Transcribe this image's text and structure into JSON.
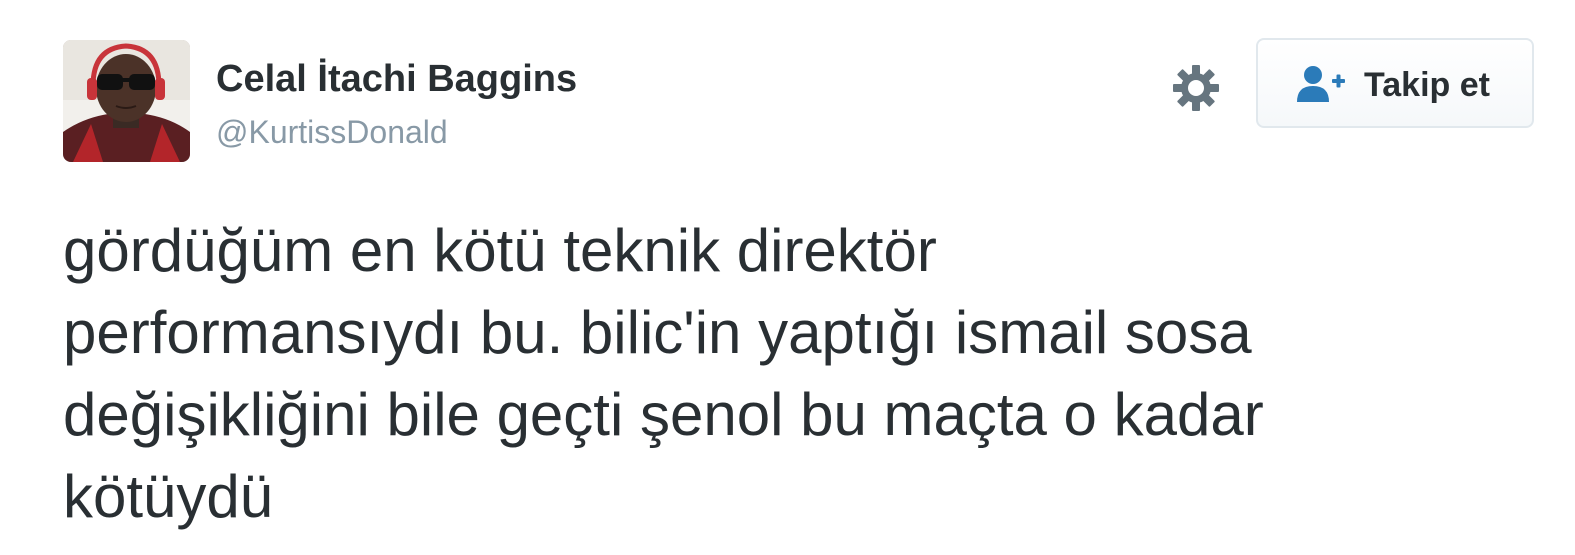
{
  "user": {
    "display_name": "Celal İtachi Baggins",
    "handle": "@KurtissDonald"
  },
  "actions": {
    "settings_icon": "gear-icon",
    "follow_icon": "add-user-icon",
    "follow_label": "Takip et",
    "accent_color": "#2b7bb9"
  },
  "tweet": {
    "lines": [
      "gördüğüm en kötü teknik direktör",
      "performansıydı bu. bilic'in yaptığı ismail sosa",
      "değişikliğini bile geçti şenol bu maçta o kadar",
      "kötüydü"
    ]
  }
}
